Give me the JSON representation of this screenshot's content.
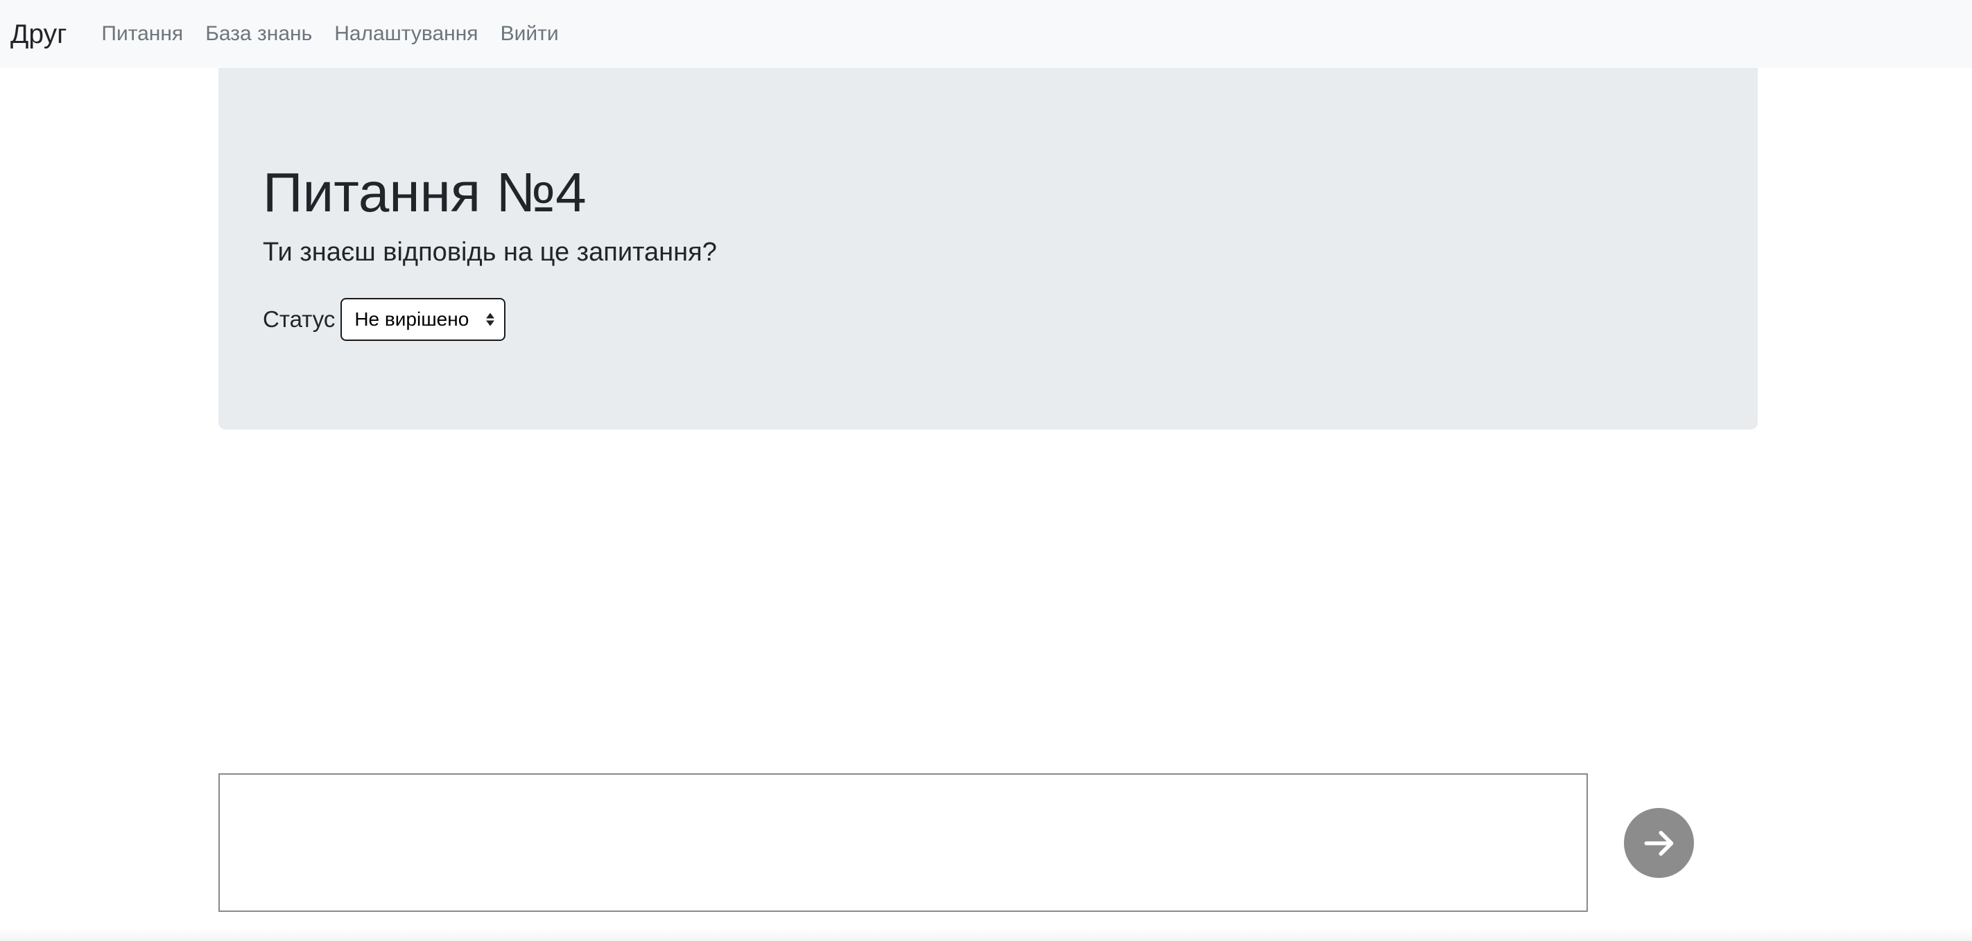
{
  "navbar": {
    "brand": "Друг",
    "links": [
      {
        "label": "Питання"
      },
      {
        "label": "База знань"
      },
      {
        "label": "Налаштування"
      },
      {
        "label": "Вийти"
      }
    ]
  },
  "hero": {
    "title": "Питання №4",
    "lead": "Ти знаєш відповідь на це запитання?",
    "status_label": "Статус",
    "status_value": "Не вирішено"
  },
  "composer": {
    "input_value": "",
    "send_icon": "arrow-right-icon"
  },
  "colors": {
    "navbar_bg": "#f8f9fa",
    "hero_bg": "#e9ecef",
    "nav_link": "#6c757d",
    "send_button_bg": "#8c8c8c"
  }
}
